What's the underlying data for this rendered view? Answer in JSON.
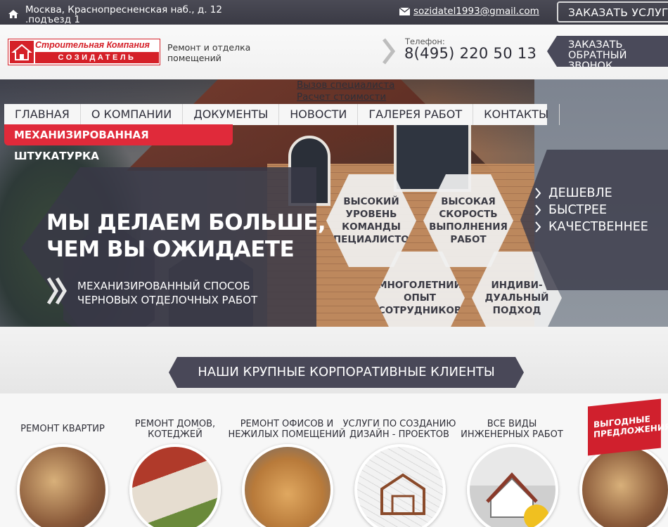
{
  "topbar": {
    "address": "Москва, Краснопресненская наб., д. 12 .подъезд 1",
    "email": "sozidatel1993@gmail.com",
    "order_button": "ЗАКАЗАТЬ УСЛУГУ",
    "home_icon": "home-icon",
    "mail_icon": "mail-icon"
  },
  "header": {
    "logo_top": "Строительная Компания",
    "logo_bottom": "СОЗИДАТЕЛЬ",
    "tagline": "Ремонт и отделка помещений",
    "phone_label": "Телефон:",
    "phone": "8(495) 220 50 13",
    "callback_line1": "ЗАКАЗАТЬ",
    "callback_line2": "ОБРАТНЫЙ ЗВОНОК"
  },
  "links": [
    "Вызов специалиста",
    "Расчет стоимости"
  ],
  "menu": [
    "ГЛАВНАЯ",
    "О КОМПАНИИ",
    "ДОКУМЕНТЫ",
    "НОВОСТИ",
    "ГАЛЕРЕЯ РАБОТ",
    "КОНТАКТЫ"
  ],
  "hero": {
    "badge": "МЕХАНИЗИРОВАННАЯ ШТУКАТУРКА",
    "headline_line1": "МЫ ДЕЛАЕМ БОЛЬШЕ,",
    "headline_line2": "ЧЕМ ВЫ ОЖИДАЕТЕ",
    "sub_line1": "МЕХАНИЗИРОВАННЫЙ СПОСОБ",
    "sub_line2": "ЧЕРНОВЫХ ОТДЕЛОЧНЫХ РАБОТ",
    "hexes": [
      {
        "line1": "ВЫСОКИЙ",
        "line2": "УРОВЕНЬ",
        "line3": "КОМАНДЫ",
        "line4": "СПЕЦИАЛИСТОВ"
      },
      {
        "line1": "ВЫСОКАЯ",
        "line2": "СКОРОСТЬ",
        "line3": "ВЫПОЛНЕНИЯ",
        "line4": "РАБОТ"
      },
      {
        "line1": "МНОГОЛЕТНИЙ",
        "line2": "ОПЫТ",
        "line3": "СОТРУДНИКОВ",
        "line4": ""
      },
      {
        "line1": "ИНДИВИ-",
        "line2": "ДУАЛЬНЫЙ",
        "line3": "ПОДХОД",
        "line4": ""
      }
    ],
    "advantages": [
      "ДЕШЕВЛЕ",
      "БЫСТРЕЕ",
      "КАЧЕСТВЕННЕЕ"
    ]
  },
  "clients_button": "НАШИ КРУПНЫЕ КОРПОРАТИВНЫЕ КЛИЕНТЫ",
  "services": [
    {
      "line1": "РЕМОНТ КВАРТИР",
      "line2": ""
    },
    {
      "line1": "РЕМОНТ ДОМОВ,",
      "line2": "КОТЕДЖЕЙ"
    },
    {
      "line1": "РЕМОНТ ОФИСОВ И",
      "line2": "НЕЖИЛЫХ ПОМЕЩЕНИЙ"
    },
    {
      "line1": "УСЛУГИ ПО СОЗДАНИЮ",
      "line2": "ДИЗАЙН - ПРОЕКТОВ"
    },
    {
      "line1": "ВСЕ ВИДЫ",
      "line2": "ИНЖЕНЕРНЫХ РАБОТ"
    }
  ],
  "offer": {
    "line1": "ВЫГОДНЫЕ",
    "line2": "ПРЕДЛОЖЕНИЯ"
  },
  "colors": {
    "accent": "#e02a3a",
    "dark": "#494858",
    "brand_red": "#d52028"
  }
}
